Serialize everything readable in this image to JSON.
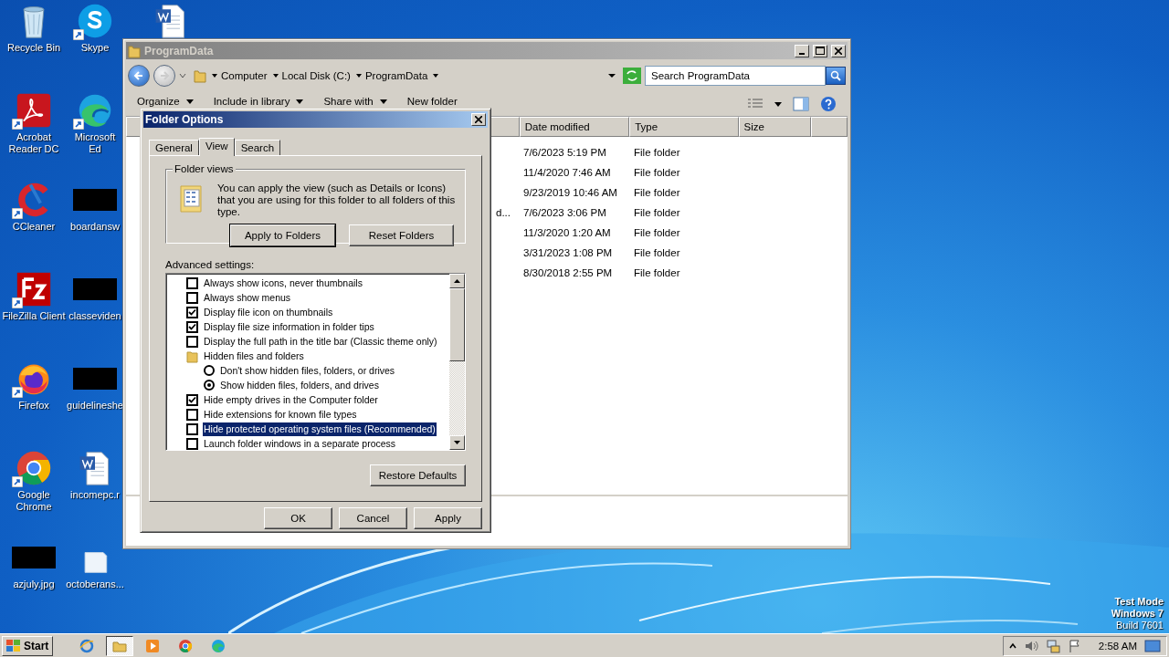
{
  "desktop": {
    "columns": [
      [
        {
          "kind": "recycle-bin",
          "label": "Recycle Bin",
          "shortcut": false
        },
        {
          "kind": "acrobat",
          "label": "Acrobat Reader DC",
          "shortcut": true
        },
        {
          "kind": "ccleaner",
          "label": "CCleaner",
          "shortcut": true
        },
        {
          "kind": "filezilla",
          "label": "FileZilla Client",
          "shortcut": true
        },
        {
          "kind": "firefox",
          "label": "Firefox",
          "shortcut": true
        },
        {
          "kind": "chrome",
          "label": "Google Chrome",
          "shortcut": true
        },
        {
          "kind": "redacted",
          "label": "azjuly.jpg",
          "shortcut": false
        }
      ],
      [
        {
          "kind": "skype",
          "label": "Skype",
          "shortcut": true
        },
        {
          "kind": "edge",
          "label": "Microsoft Ed",
          "shortcut": true
        },
        {
          "kind": "redacted",
          "label": "boardansw",
          "shortcut": false
        },
        {
          "kind": "redacted",
          "label": "classeviden",
          "shortcut": false
        },
        {
          "kind": "redacted",
          "label": "guidelineshe",
          "shortcut": false
        },
        {
          "kind": "word",
          "label": "incomepc.r",
          "shortcut": false
        },
        {
          "kind": "document",
          "label": "octoberans...",
          "shortcut": false
        }
      ],
      [
        {
          "kind": "word",
          "shortcut": false
        }
      ]
    ],
    "system_info": [
      "Test Mode",
      "Windows 7",
      "Build 7601"
    ]
  },
  "explorer": {
    "title": "ProgramData",
    "breadcrumb": [
      "Computer",
      "Local Disk (C:)",
      "ProgramData"
    ],
    "search": {
      "placeholder": "Search ProgramData"
    },
    "toolbar": [
      {
        "label": "Organize",
        "dropdown": true
      },
      {
        "label": "Include in library",
        "dropdown": true
      },
      {
        "label": "Share with",
        "dropdown": true
      },
      {
        "label": "New folder",
        "dropdown": false
      }
    ],
    "columns": [
      "Date modified",
      "Type",
      "Size"
    ],
    "rows": [
      {
        "date": "7/6/2023 5:19 PM",
        "type": "File folder"
      },
      {
        "date": "11/4/2020 7:46 AM",
        "type": "File folder"
      },
      {
        "date": "9/23/2019 10:46 AM",
        "type": "File folder"
      },
      {
        "name": "d...",
        "date": "7/6/2023 3:06 PM",
        "type": "File folder"
      },
      {
        "date": "11/3/2020 1:20 AM",
        "type": "File folder"
      },
      {
        "date": "3/31/2023 1:08 PM",
        "type": "File folder"
      },
      {
        "date": "8/30/2018 2:55 PM",
        "type": "File folder"
      }
    ]
  },
  "folder_options": {
    "title": "Folder Options",
    "tabs": [
      {
        "label": "General",
        "selected": false
      },
      {
        "label": "View",
        "selected": true
      },
      {
        "label": "Search",
        "selected": false
      }
    ],
    "folder_views": {
      "title": "Folder views",
      "description": "You can apply the view (such as Details or Icons) that you are using for this folder to all folders of this type.",
      "buttons": [
        {
          "label": "Apply to Folders",
          "default": true
        },
        {
          "label": "Reset Folders",
          "default": false
        }
      ]
    },
    "advanced_settings": {
      "label": "Advanced settings:",
      "items": [
        {
          "kind": "checkbox",
          "label": "Always show icons, never thumbnails",
          "checked": false,
          "selected": false
        },
        {
          "kind": "checkbox",
          "label": "Always show menus",
          "checked": false,
          "selected": false
        },
        {
          "kind": "checkbox",
          "label": "Display file icon on thumbnails",
          "checked": true,
          "selected": false
        },
        {
          "kind": "checkbox",
          "label": "Display file size information in folder tips",
          "checked": true,
          "selected": false
        },
        {
          "kind": "checkbox",
          "label": "Display the full path in the title bar (Classic theme only)",
          "checked": false,
          "selected": false
        },
        {
          "kind": "folder",
          "label": "Hidden files and folders",
          "selected": false,
          "children": [
            {
              "kind": "radio",
              "label": "Don't show hidden files, folders, or drives",
              "checked": false,
              "selected": false
            },
            {
              "kind": "radio",
              "label": "Show hidden files, folders, and drives",
              "checked": true,
              "selected": false
            }
          ]
        },
        {
          "kind": "checkbox",
          "label": "Hide empty drives in the Computer folder",
          "checked": true,
          "selected": false
        },
        {
          "kind": "checkbox",
          "label": "Hide extensions for known file types",
          "checked": false,
          "selected": false
        },
        {
          "kind": "checkbox",
          "label": "Hide protected operating system files (Recommended)",
          "checked": false,
          "selected": true
        },
        {
          "kind": "checkbox",
          "label": "Launch folder windows in a separate process",
          "checked": false,
          "selected": false
        }
      ]
    },
    "restore_button": "Restore Defaults",
    "buttons": [
      "OK",
      "Cancel",
      "Apply"
    ]
  },
  "taskbar": {
    "start": "Start",
    "pinned": [
      {
        "kind": "ie",
        "active": false
      },
      {
        "kind": "explorer",
        "active": true
      },
      {
        "kind": "media",
        "active": false
      },
      {
        "kind": "chrome",
        "active": false
      },
      {
        "kind": "edge",
        "active": false
      }
    ],
    "clock": "2:58 AM"
  }
}
